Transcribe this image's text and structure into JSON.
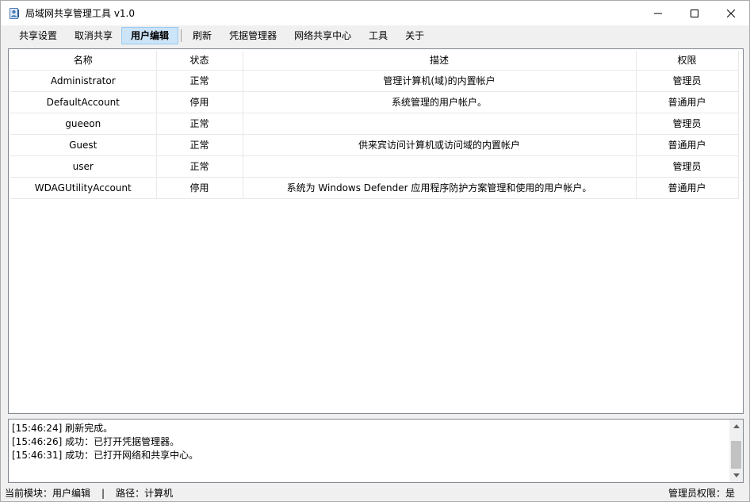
{
  "window": {
    "title": "局域网共享管理工具 v1.0",
    "icon": "user-book-icon"
  },
  "menu": {
    "items": [
      {
        "label": "共享设置"
      },
      {
        "label": "取消共享"
      },
      {
        "label": "用户编辑",
        "active": true
      },
      {
        "label": "刷新"
      },
      {
        "label": "凭据管理器"
      },
      {
        "label": "网络共享中心"
      },
      {
        "label": "工具"
      },
      {
        "label": "关于"
      }
    ]
  },
  "table": {
    "headers": [
      "名称",
      "状态",
      "描述",
      "权限"
    ],
    "rows": [
      {
        "name": "Administrator",
        "status": "正常",
        "desc": "管理计算机(域)的内置帐户",
        "role": "管理员"
      },
      {
        "name": "DefaultAccount",
        "status": "停用",
        "desc": "系统管理的用户帐户。",
        "role": "普通用户"
      },
      {
        "name": "gueeon",
        "status": "正常",
        "desc": "",
        "role": "管理员"
      },
      {
        "name": "Guest",
        "status": "正常",
        "desc": "供来宾访问计算机或访问域的内置帐户",
        "role": "普通用户"
      },
      {
        "name": "user",
        "status": "正常",
        "desc": "",
        "role": "管理员"
      },
      {
        "name": "WDAGUtilityAccount",
        "status": "停用",
        "desc": "系统为 Windows Defender 应用程序防护方案管理和使用的用户帐户。",
        "role": "普通用户"
      }
    ]
  },
  "log": {
    "lines": [
      "[15:46:24] 刷新完成。",
      "[15:46:26] 成功：已打开凭据管理器。",
      "[15:46:31] 成功：已打开网络和共享中心。"
    ]
  },
  "status": {
    "module_label": "当前模块：用户编辑",
    "pipe": "|",
    "path_label": "路径：计算机",
    "admin_label": "管理员权限：是"
  }
}
